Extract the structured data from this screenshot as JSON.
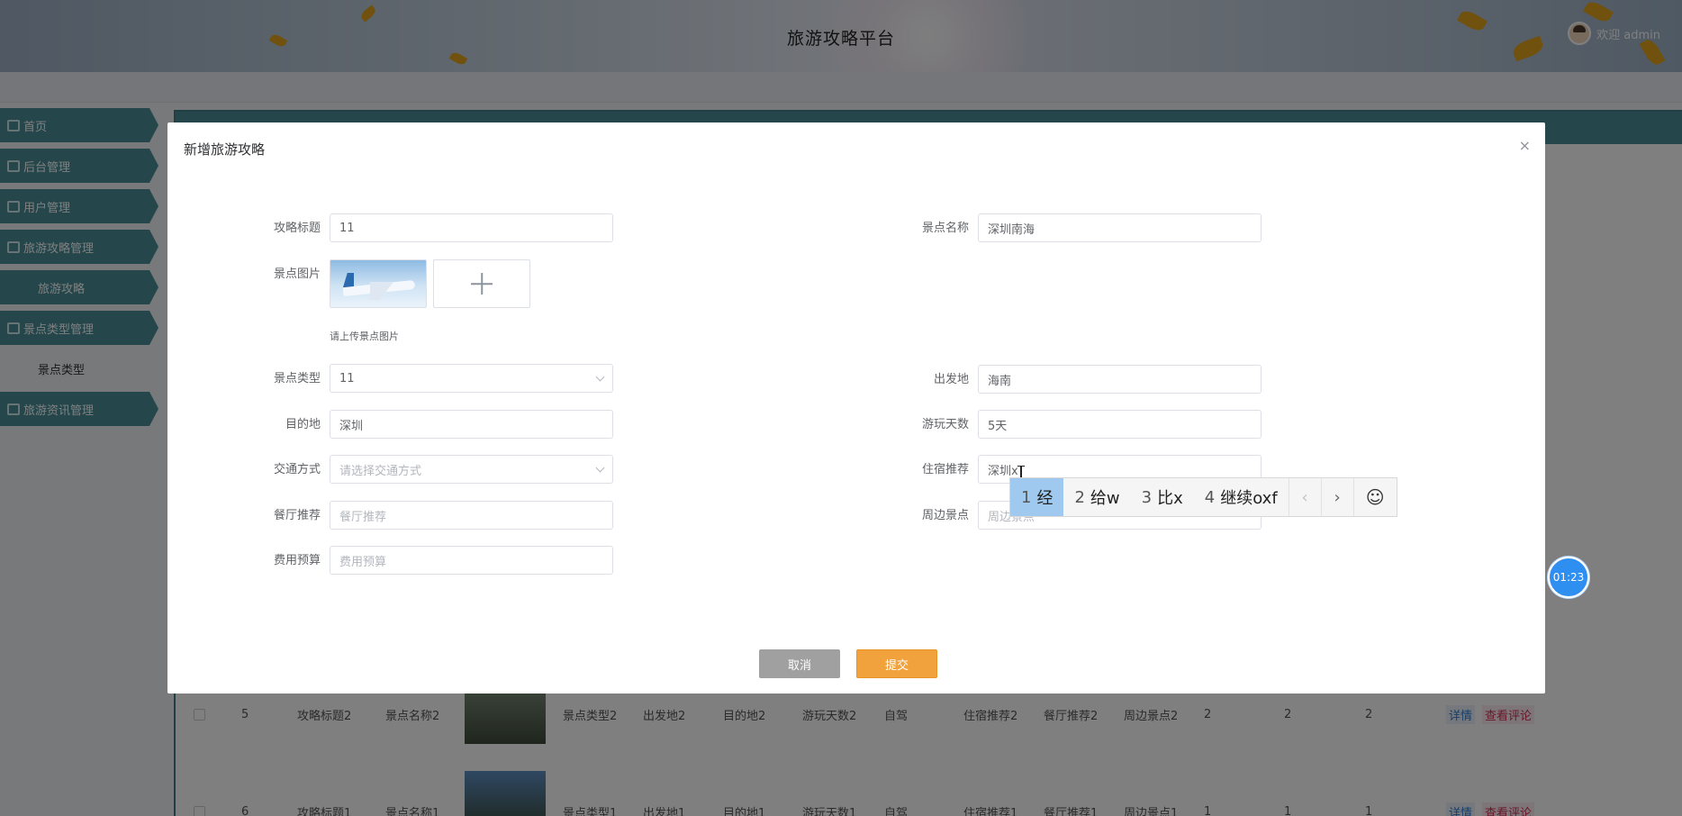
{
  "header": {
    "title": "旅游攻略平台",
    "welcome": "欢迎 admin"
  },
  "sidebar": {
    "items": [
      {
        "label": "首页"
      },
      {
        "label": "后台管理"
      },
      {
        "label": "用户管理"
      },
      {
        "label": "旅游攻略管理"
      },
      {
        "label": "旅游攻略"
      },
      {
        "label": "景点类型管理"
      },
      {
        "label": "景点类型"
      },
      {
        "label": "旅游资讯管理"
      }
    ]
  },
  "table_rows": [
    {
      "index": "5",
      "title": "攻略标题2",
      "spot": "景点名称2",
      "type": "景点类型2",
      "from": "出发地2",
      "dest": "目的地2",
      "days": "游玩天数2",
      "transport": "自驾",
      "hotel": "住宿推荐2",
      "restaurant": "餐厅推荐2",
      "nearby": "周边景点2",
      "c1": "2",
      "c2": "2",
      "c3": "2",
      "detail": "详情",
      "comments": "查看评论"
    },
    {
      "index": "6",
      "title": "攻略标题1",
      "spot": "景点名称1",
      "type": "景点类型1",
      "from": "出发地1",
      "dest": "目的地1",
      "days": "游玩天数1",
      "transport": "自驾",
      "hotel": "住宿推荐1",
      "restaurant": "餐厅推荐1",
      "nearby": "周边景点1",
      "c1": "1",
      "c2": "1",
      "c3": "1",
      "detail": "详情",
      "comments": "查看评论"
    }
  ],
  "dialog": {
    "title": "新增旅游攻略",
    "close": "×",
    "fields": {
      "title": {
        "label": "攻略标题",
        "value": "11"
      },
      "spot_name": {
        "label": "景点名称",
        "value": "深圳南海"
      },
      "spot_image": {
        "label": "景点图片",
        "tip": "请上传景点图片"
      },
      "spot_type": {
        "label": "景点类型",
        "value": "11"
      },
      "departure": {
        "label": "出发地",
        "value": "海南"
      },
      "destination": {
        "label": "目的地",
        "value": "深圳"
      },
      "days": {
        "label": "游玩天数",
        "value": "5天"
      },
      "transport": {
        "label": "交通方式",
        "placeholder": "请选择交通方式"
      },
      "hotel": {
        "label": "住宿推荐",
        "value": "深圳x"
      },
      "restaurant": {
        "label": "餐厅推荐",
        "placeholder": "餐厅推荐"
      },
      "nearby": {
        "label": "周边景点",
        "placeholder": "周边景点"
      },
      "budget": {
        "label": "费用预算",
        "placeholder": "费用预算"
      }
    },
    "cancel": "取消",
    "submit": "提交"
  },
  "ime": {
    "candidates": [
      {
        "n": "1",
        "text": "经"
      },
      {
        "n": "2",
        "text": "给w"
      },
      {
        "n": "3",
        "text": "比x"
      },
      {
        "n": "4",
        "text": "继续oxf"
      }
    ],
    "prev": "‹",
    "next": "›",
    "emoji": "☺"
  },
  "timer": "01:23"
}
